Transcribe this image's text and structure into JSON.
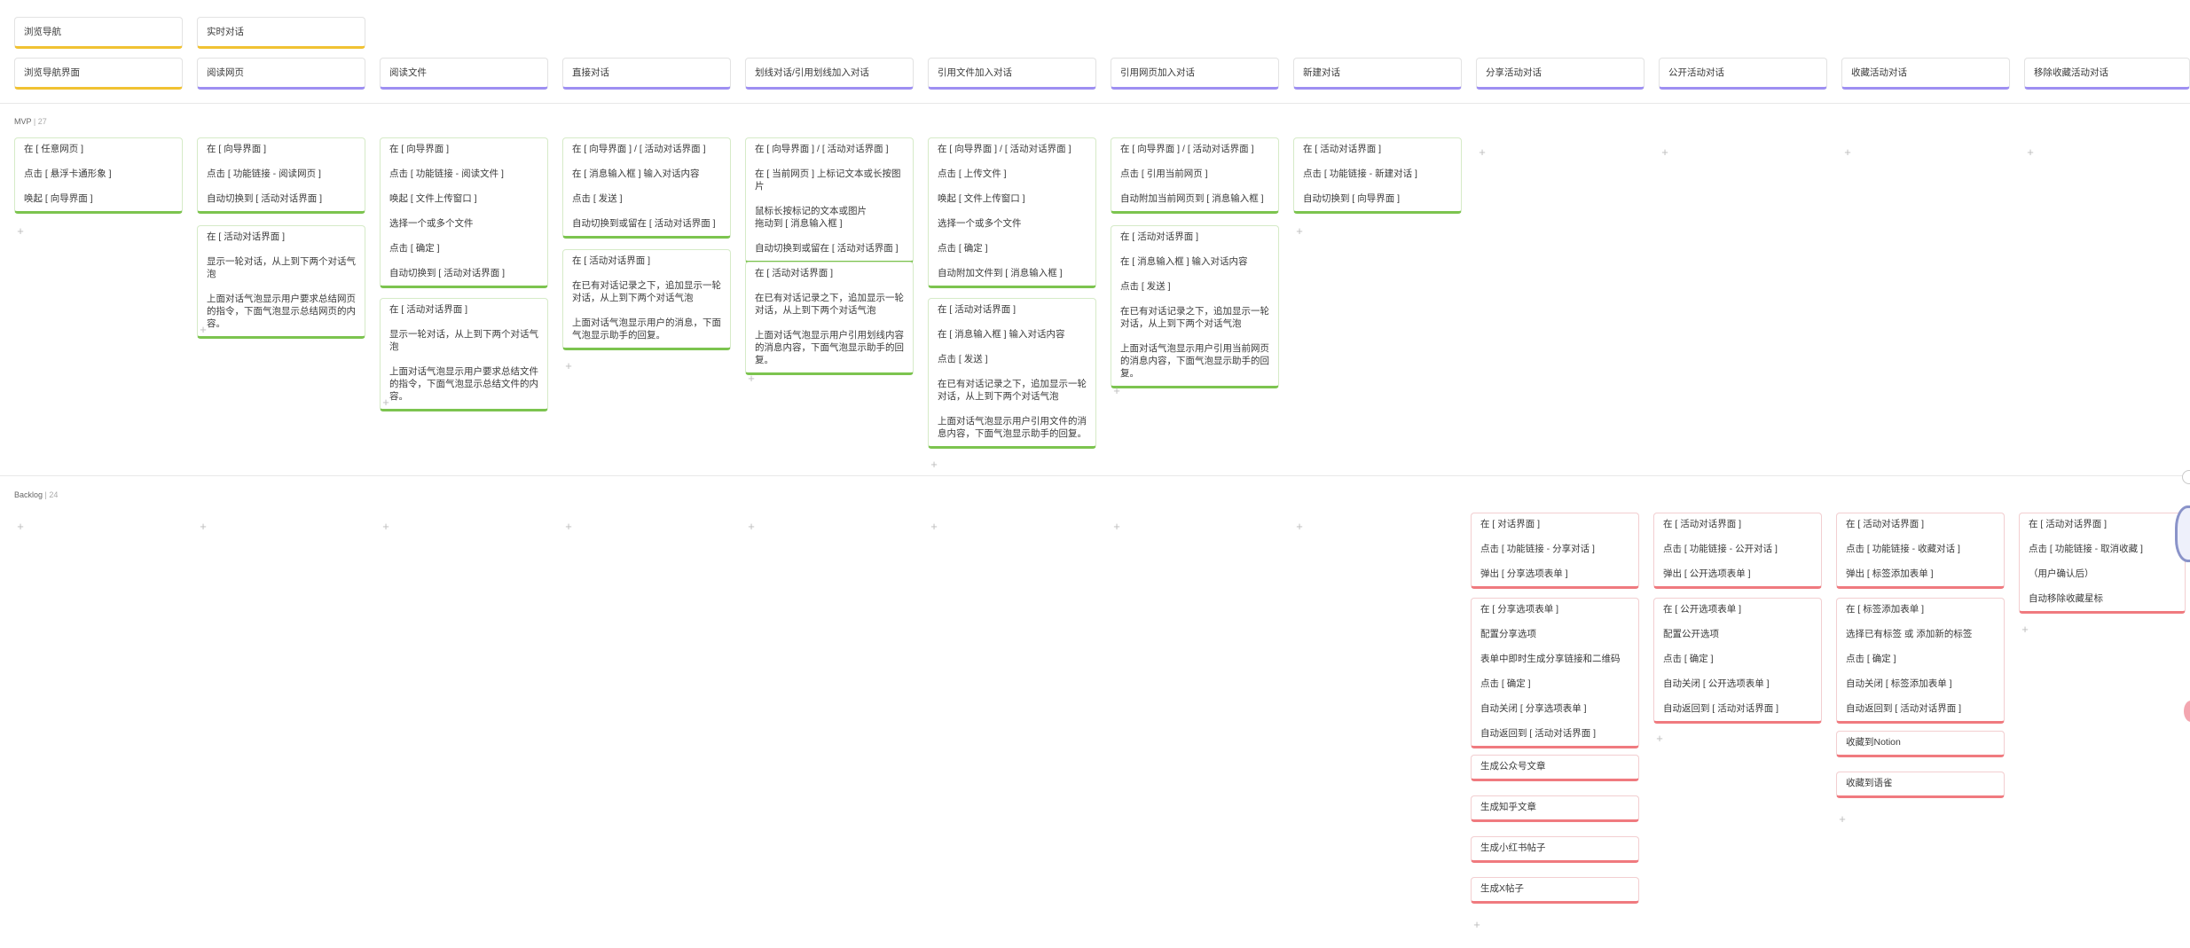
{
  "epics": {
    "row1": [
      "浏览导航",
      "实时对话"
    ],
    "row2": [
      "浏览导航界面",
      "阅读网页",
      "阅读文件",
      "直接对话",
      "划线对话/引用划线加入对话",
      "引用文件加入对话",
      "引用网页加入对话",
      "新建对话",
      "分享活动对话",
      "公开活动对话",
      "收藏活动对话",
      "移除收藏活动对话"
    ]
  },
  "sections": {
    "mvp": {
      "name": "MVP",
      "count": "27"
    },
    "backlog": {
      "name": "Backlog",
      "count": "24"
    }
  },
  "mvp": {
    "col1": [
      [
        "在 [ 任意网页 ]",
        "点击 [ 悬浮卡通形象 ]",
        "唤起 [ 向导界面 ]"
      ]
    ],
    "col2": [
      [
        "在 [ 向导界面 ]",
        "点击 [ 功能链接 - 阅读网页 ]",
        "自动切换到 [ 活动对话界面 ]"
      ],
      [
        "在 [ 活动对话界面 ]",
        "显示一轮对话，从上到下两个对话气泡",
        "上面对话气泡显示用户要求总结网页的指令，下面气泡显示总结网页的内容。"
      ]
    ],
    "col3": [
      [
        "在 [ 向导界面 ]",
        "点击 [ 功能链接 - 阅读文件 ]",
        "唤起 [ 文件上传窗口 ]",
        "选择一个或多个文件",
        "点击 [ 确定 ]",
        "自动切换到 [ 活动对话界面 ]"
      ],
      [
        "在 [ 活动对话界面 ]",
        "显示一轮对话，从上到下两个对话气泡",
        "上面对话气泡显示用户要求总结文件的指令，下面气泡显示总结文件的内容。"
      ]
    ],
    "col4": [
      [
        "在 [ 向导界面 ] / [ 活动对话界面 ]",
        "在 [ 消息输入框 ] 输入对话内容",
        "点击 [ 发送 ]",
        "自动切换到或留在 [ 活动对话界面 ]"
      ],
      [
        "在 [ 活动对话界面 ]",
        "在已有对话记录之下，追加显示一轮对话，从上到下两个对话气泡",
        "上面对话气泡显示用户的消息，下面气泡显示助手的回复。"
      ]
    ],
    "col5": [
      [
        "在 [ 向导界面 ] / [ 活动对话界面 ]",
        "在 [ 当前网页 ] 上标记文本或长按图片",
        "鼠标长按标记的文本或图片",
        "拖动到 [ 消息输入框 ]",
        "自动切换到或留在 [ 活动对话界面 ]"
      ],
      [
        "在 [ 活动对话界面 ]",
        "在已有对话记录之下，追加显示一轮对话，从上到下两个对话气泡",
        "上面对话气泡显示用户引用划线内容的消息内容，下面气泡显示助手的回复。"
      ]
    ],
    "col6": [
      [
        "在 [ 向导界面 ] / [ 活动对话界面 ]",
        "点击 [ 上传文件 ]",
        "唤起 [ 文件上传窗口 ]",
        "选择一个或多个文件",
        "点击 [ 确定 ]",
        "自动附加文件到 [ 消息输入框 ]"
      ],
      [
        "在 [ 活动对话界面 ]",
        "在 [ 消息输入框 ] 输入对话内容",
        "点击 [ 发送 ]",
        "在已有对话记录之下，追加显示一轮对话，从上到下两个对话气泡",
        "上面对话气泡显示用户引用文件的消息内容，下面气泡显示助手的回复。"
      ]
    ],
    "col7": [
      [
        "在 [ 向导界面 ] / [ 活动对话界面 ]",
        "点击 [ 引用当前网页 ]",
        "自动附加当前网页到 [ 消息输入框 ]"
      ],
      [
        "在 [ 活动对话界面 ]",
        "在 [ 消息输入框 ] 输入对话内容",
        "点击 [ 发送 ]",
        "在已有对话记录之下，追加显示一轮对话，从上到下两个对话气泡",
        "上面对话气泡显示用户引用当前网页的消息内容，下面气泡显示助手的回复。"
      ]
    ],
    "col8": [
      [
        "在 [ 活动对话界面 ]",
        "点击 [ 功能链接 - 新建对话 ]",
        "自动切换到 [ 向导界面 ]"
      ]
    ]
  },
  "backlog": {
    "col9": [
      [
        "在 [ 对话界面 ]",
        "点击 [ 功能链接 - 分享对话 ]",
        "弹出 [ 分享选项表单 ]"
      ],
      [
        "在 [ 分享选项表单 ]",
        "配置分享选项",
        "表单中即时生成分享链接和二维码",
        "点击 [ 确定 ]",
        "自动关闭 [ 分享选项表单 ]",
        "自动返回到 [ 活动对话界面 ]"
      ],
      [
        "生成公众号文章"
      ],
      [
        "生成知乎文章"
      ],
      [
        "生成小红书帖子"
      ],
      [
        "生成X帖子"
      ]
    ],
    "col10": [
      [
        "在 [ 活动对话界面 ]",
        "点击 [ 功能链接 - 公开对话 ]",
        "弹出 [ 公开选项表单 ]"
      ],
      [
        "在 [ 公开选项表单 ]",
        "配置公开选项",
        "点击 [ 确定 ]",
        "自动关闭 [ 公开选项表单 ]",
        "自动返回到 [ 活动对话界面 ]"
      ]
    ],
    "col11": [
      [
        "在 [ 活动对话界面 ]",
        "点击 [ 功能链接 - 收藏对话 ]",
        "弹出 [ 标签添加表单 ]"
      ],
      [
        "在 [ 标签添加表单 ]",
        "选择已有标签 或 添加新的标签",
        "点击 [ 确定 ]",
        "自动关闭 [ 标签添加表单 ]",
        "自动返回到 [ 活动对话界面 ]"
      ],
      [
        "收藏到Notion"
      ],
      [
        "收藏到语雀"
      ]
    ],
    "col12": [
      [
        "在 [ 活动对话界面 ]",
        "点击 [ 功能链接 - 取消收藏 ]",
        "（用户确认后）",
        "自动移除收藏星标"
      ]
    ]
  },
  "add_symbol": "+",
  "colors": {
    "epic": "#f1c232",
    "feature": "#9e8ff2",
    "mvp_story": "#7cc44f",
    "backlog_story": "#f07a7f"
  }
}
